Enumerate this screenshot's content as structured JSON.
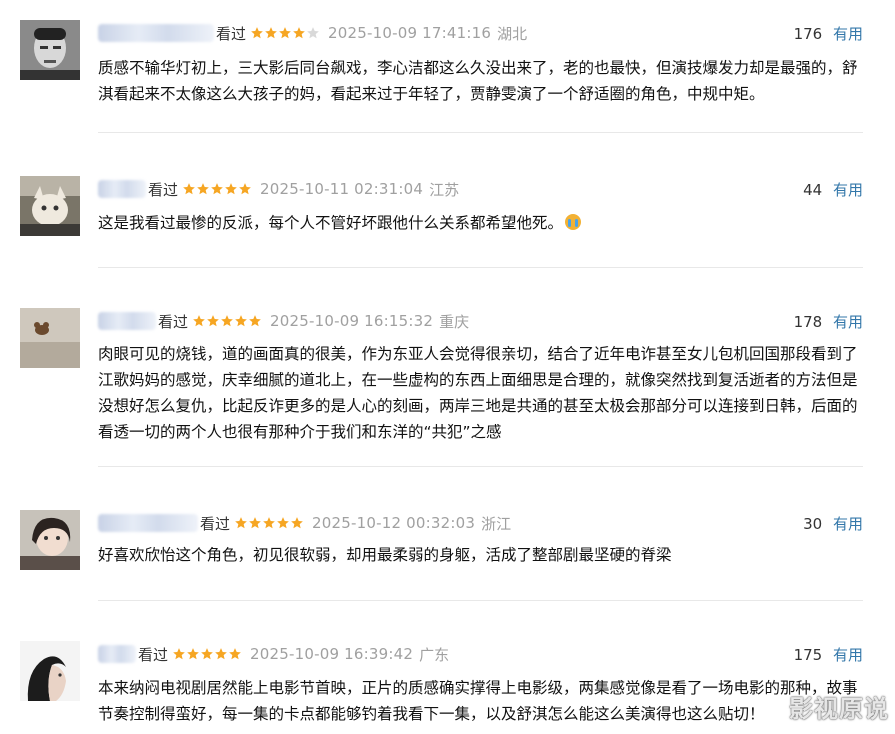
{
  "comments": [
    {
      "watched": "看过",
      "rating": 4,
      "timestamp": "2025-10-09 17:41:16",
      "location": "湖北",
      "votes": "176",
      "useful": "有用",
      "content": "质感不输华灯初上，三大影后同台飙戏，李心洁都这么久没出来了，老的也最快，但演技爆发力却是最强的，舒淇看起来不太像这么大孩子的妈，看起来过于年轻了，贾静雯演了一个舒适圈的角色，中规中矩。"
    },
    {
      "watched": "看过",
      "rating": 5,
      "timestamp": "2025-10-11 02:31:04",
      "location": "江苏",
      "votes": "44",
      "useful": "有用",
      "content": "这是我看过最惨的反派，每个人不管好坏跟他什么关系都希望他死。"
    },
    {
      "watched": "看过",
      "rating": 5,
      "timestamp": "2025-10-09 16:15:32",
      "location": "重庆",
      "votes": "178",
      "useful": "有用",
      "content": "肉眼可见的烧钱，道的画面真的很美，作为东亚人会觉得很亲切，结合了近年电诈甚至女儿包机回国那段看到了江歌妈妈的感觉，庆幸细腻的道北上，在一些虚构的东西上面细思是合理的，就像突然找到复活逝者的方法但是没想好怎么复仇，比起反诈更多的是人心的刻画，两岸三地是共通的甚至太极会那部分可以连接到日韩，后面的看透一切的两个人也很有那种介于我们和东洋的“共犯”之感"
    },
    {
      "watched": "看过",
      "rating": 5,
      "timestamp": "2025-10-12 00:32:03",
      "location": "浙江",
      "votes": "30",
      "useful": "有用",
      "content": "好喜欢欣怡这个角色，初见很软弱，却用最柔弱的身躯，活成了整部剧最坚硬的脊梁"
    },
    {
      "watched": "看过",
      "rating": 5,
      "timestamp": "2025-10-09 16:39:42",
      "location": "广东",
      "votes": "175",
      "useful": "有用",
      "content": "本来纳闷电视剧居然能上电影节首映，正片的质感确实撑得上电影级，两集感觉像是看了一场电影的那种，故事节奏控制得蛮好，每一集的卡点都能够钓着我看下一集，以及舒淇怎么能这么美演得也这么贴切！"
    }
  ],
  "watermark": "影视原说",
  "colors": {
    "star": "#f6a623",
    "star_empty": "#d9d9d9",
    "link": "#3377aa",
    "meta": "#a0a0a0"
  }
}
